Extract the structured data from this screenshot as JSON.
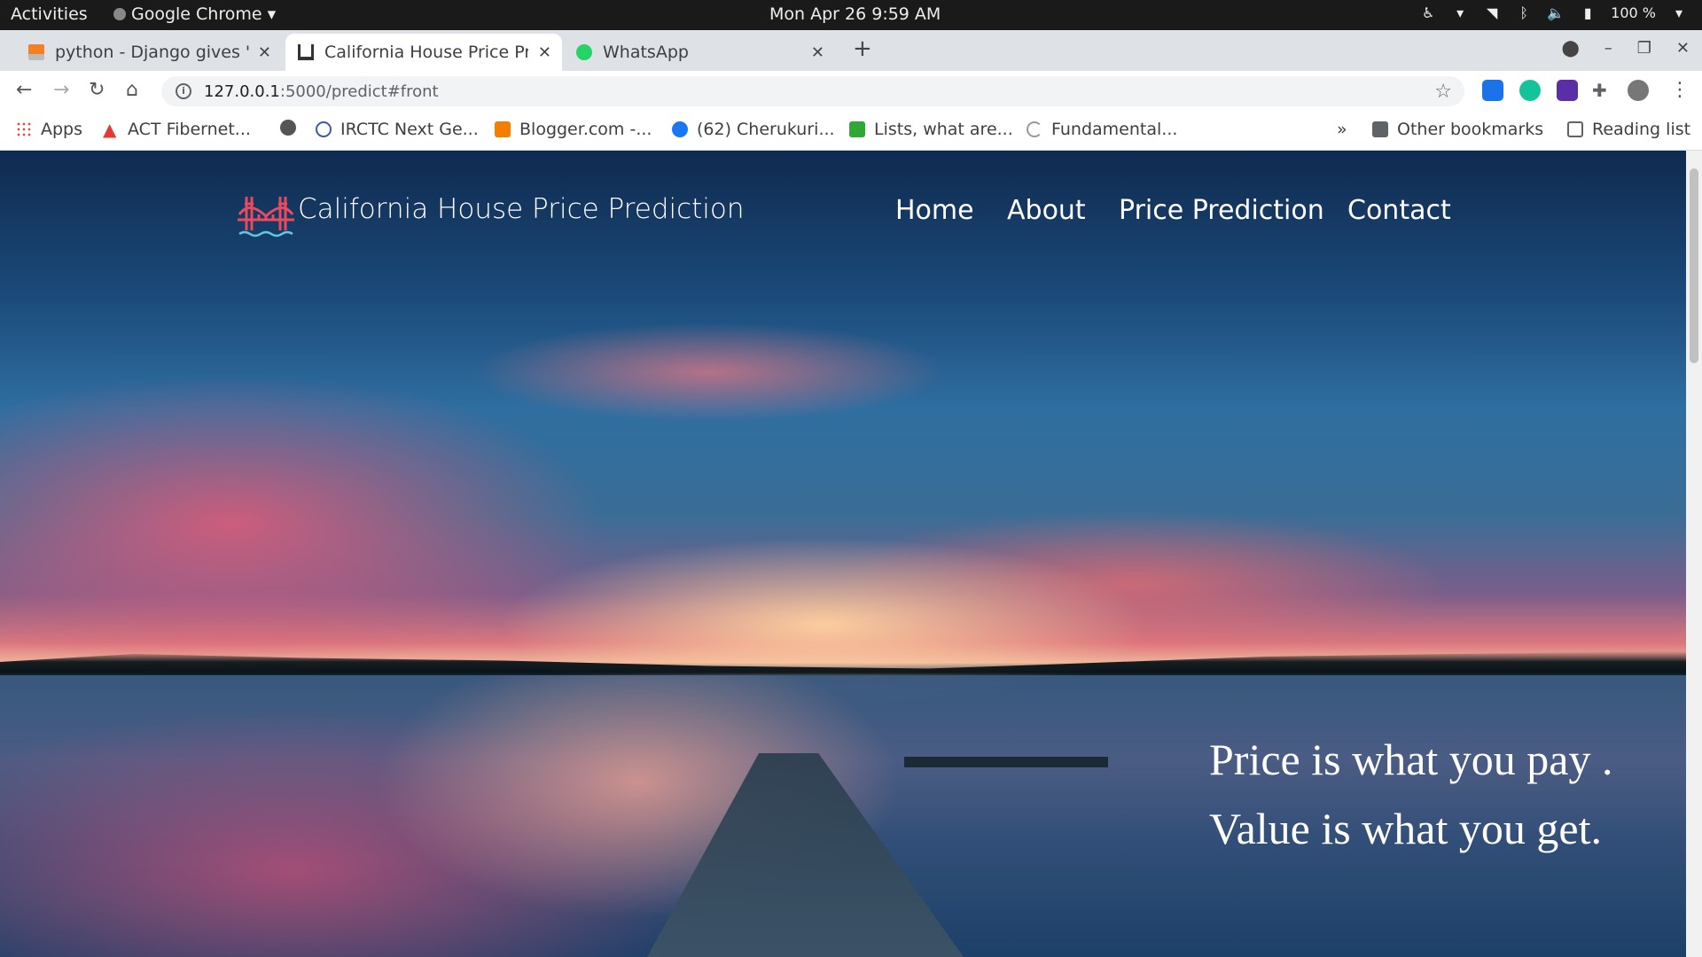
{
  "system_bar": {
    "activities": "Activities",
    "app_name": "Google Chrome",
    "clock": "Mon Apr 26   9:59 AM",
    "battery": "100 %"
  },
  "tabs": [
    {
      "title": "python - Django gives \"GE",
      "active": false
    },
    {
      "title": "California House Price Pre",
      "active": true
    },
    {
      "title": "WhatsApp",
      "active": false
    }
  ],
  "address_bar": {
    "host": "127.0.0.1",
    "path": ":5000/predict#front"
  },
  "bookmarks": {
    "items": [
      "Apps",
      "ACT Fibernet...",
      "IRCTC Next Ge...",
      "Blogger.com -...",
      "(62) Cherukuri...",
      "Lists, what are...",
      "Fundamental..."
    ],
    "overflow": "»",
    "other": "Other bookmarks",
    "reading_list": "Reading list"
  },
  "site": {
    "brand": "California House Price Prediction",
    "nav": [
      "Home",
      "About",
      "Price Prediction",
      "Contact"
    ],
    "quote_line1": "Price is what you pay .",
    "quote_line2": "Value is what you get."
  },
  "colors": {
    "logo_accent": "#e84a5f",
    "logo_water": "#5ec9e0",
    "tab_strip": "#dee1e6"
  }
}
